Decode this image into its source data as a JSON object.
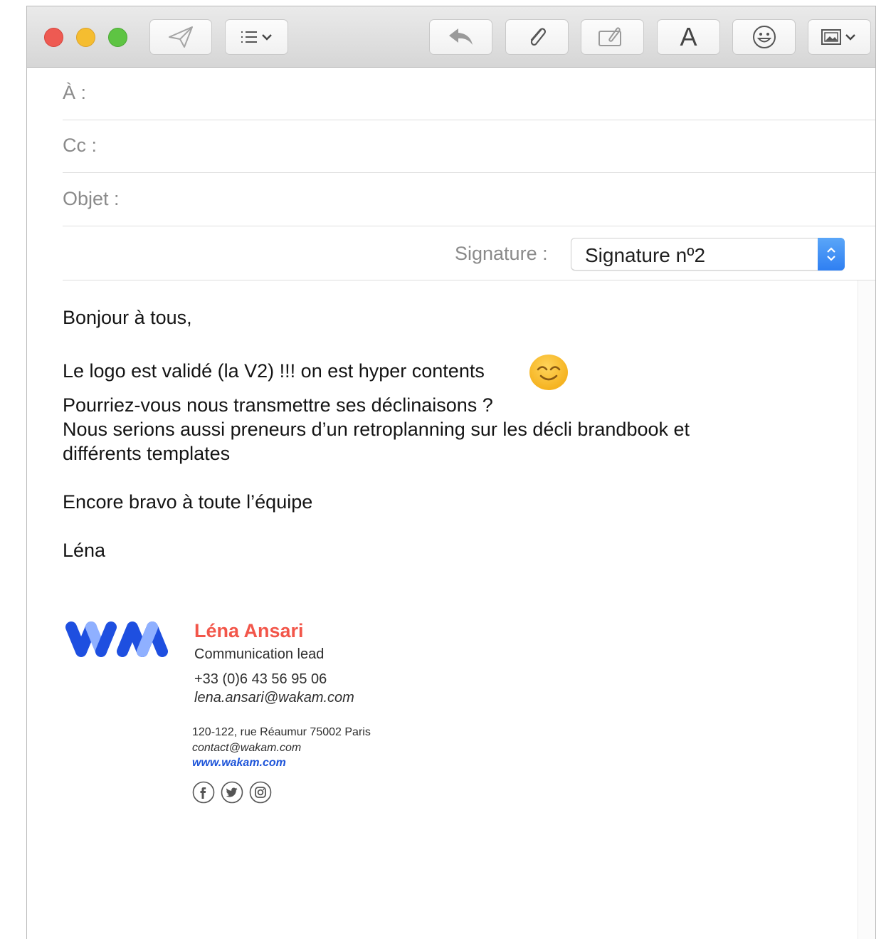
{
  "toolbar": {
    "buttons": [
      "send",
      "header-fields",
      "reply",
      "attach",
      "markup",
      "format",
      "emoji",
      "photo-browser"
    ],
    "format_label": "A"
  },
  "fields": {
    "to_label": "À :",
    "cc_label": "Cc :",
    "subject_label": "Objet :",
    "to_value": "",
    "cc_value": "",
    "subject_value": ""
  },
  "signature": {
    "label": "Signature :",
    "selected": "Signature nº2"
  },
  "message": {
    "greeting": "Bonjour à tous,",
    "line1": "Le logo est validé (la V2) !!! on est hyper contents",
    "line2": "Pourriez-vous nous transmettre ses déclinaisons ?",
    "line3": "Nous serions aussi preneurs d’un retroplanning sur les décli brandbook et",
    "line4": "différents templates",
    "line5": "Encore bravo à toute l’équipe",
    "signoff": "Léna"
  },
  "email_signature": {
    "name": "Léna Ansari",
    "role": "Communication lead",
    "phone": "+33 (0)6 43 56 95 06",
    "email": "lena.ansari@wakam.com",
    "address": "120-122, rue Réaumur 75002 Paris",
    "contact": "contact@wakam.com",
    "website": "www.wakam.com",
    "social_icons": [
      "facebook-icon",
      "twitter-icon",
      "instagram-icon"
    ]
  },
  "colors": {
    "accent_name": "#f2564a",
    "link": "#1d54d9",
    "logo_dark": "#1e4fe0",
    "logo_light": "#8fb0ff",
    "select_blue": "#2f7ff2"
  }
}
